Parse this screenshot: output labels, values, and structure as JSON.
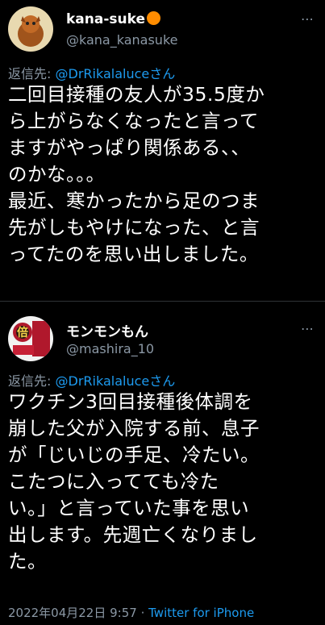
{
  "tweets": [
    {
      "name": "kana-suke",
      "handle": "@kana_kanasuke",
      "reply_prefix": "返信先:",
      "reply_to": "@DrRikalaluceさん",
      "lines": [
        "二回目接種の友人が35.5度か",
        "ら上がらなくなったと言って",
        "ますがやっぱり関係ある、、",
        "のかな。。。",
        "最近、寒かったから足のつま",
        "先がしもやけになった、と言",
        "ってたのを思い出しました。"
      ]
    },
    {
      "name": "モンモンもん",
      "handle": "@mashira_10",
      "avatar_text": "倍",
      "reply_prefix": "返信先:",
      "reply_to": "@DrRikalaluceさん",
      "lines": [
        "ワクチン3回目接種後体調を",
        "崩した父が入院する前、息子",
        "が「じいじの手足、冷たい。",
        "こたつに入ってても冷た",
        "い。」と言っていた事を思い",
        "出します。先週亡くなりまし",
        "た。"
      ],
      "timestamp": "2022年04月22日 9:57",
      "separator": " · ",
      "source": "Twitter for iPhone"
    }
  ],
  "colors": {
    "background": "#000000",
    "text": "#ffffff",
    "muted": "#8b98a5",
    "link": "#1d9bf0"
  }
}
